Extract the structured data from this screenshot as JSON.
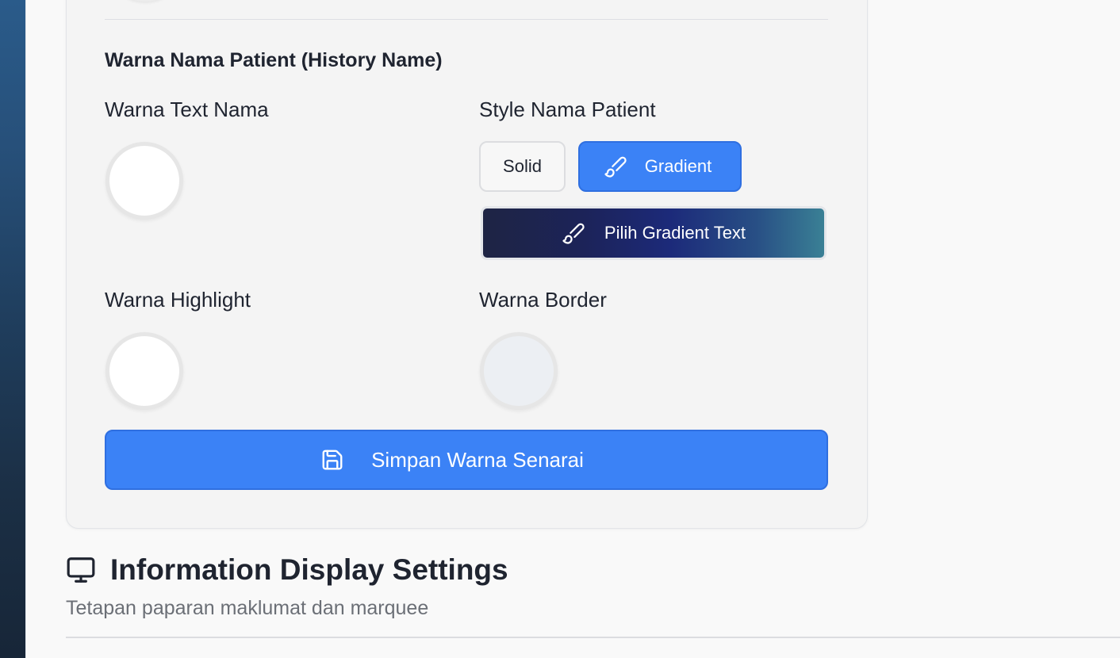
{
  "sidebar": {
    "background_top": "#2a5b8a",
    "background_bottom": "#172638"
  },
  "card": {
    "section_title": "Warna Nama Patient (History Name)",
    "fields": {
      "text_color": {
        "label": "Warna Text Nama",
        "value": "#ffffff"
      },
      "style": {
        "label": "Style Nama Patient",
        "options": [
          "Solid",
          "Gradient"
        ],
        "selected": "Gradient",
        "gradient_button_label": "Pilih Gradient Text",
        "gradient_colors": [
          "#1e2444",
          "#1c2359",
          "#1c2a7a",
          "#3a8095"
        ]
      },
      "highlight_color": {
        "label": "Warna Highlight",
        "value": "#ffffff"
      },
      "border_color": {
        "label": "Warna Border",
        "value": "#eceff3"
      }
    },
    "save_button_label": "Simpan Warna Senarai"
  },
  "info_section": {
    "title": "Information Display Settings",
    "subtitle": "Tetapan paparan maklumat dan marquee"
  },
  "icons": {
    "gradient_option": "paintbrush-icon",
    "pick_gradient": "paintbrush-icon",
    "save": "save-icon",
    "info": "monitor-icon"
  },
  "colors": {
    "accent": "#3b82f6",
    "card_bg": "#f4f4f4",
    "page_bg": "#f9f9f9",
    "text": "#1f2430",
    "muted_text": "#6b6f76"
  }
}
